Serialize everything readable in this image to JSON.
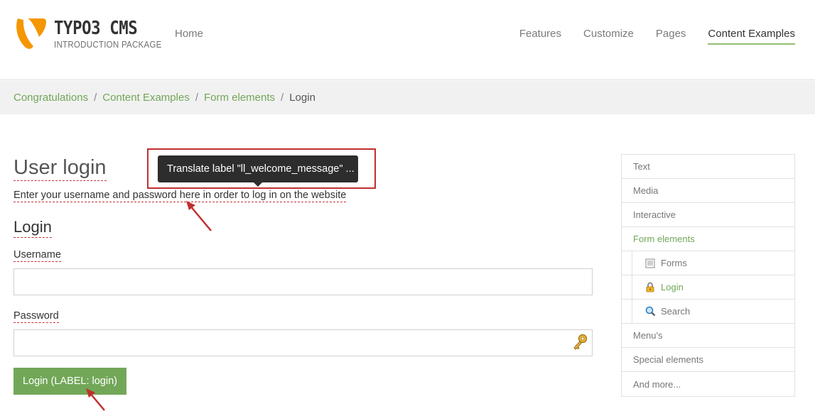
{
  "header": {
    "logo": {
      "title": "TYPO3 CMS",
      "subtitle": "INTRODUCTION PACKAGE",
      "brand_color": "#f49700"
    },
    "nav_home": "Home",
    "nav_items": [
      {
        "label": "Features",
        "active": false
      },
      {
        "label": "Customize",
        "active": false
      },
      {
        "label": "Pages",
        "active": false
      },
      {
        "label": "Content Examples",
        "active": true
      }
    ]
  },
  "breadcrumb": {
    "items": [
      "Congratulations",
      "Content Examples",
      "Form elements"
    ],
    "separator": "/",
    "current": "Login"
  },
  "main": {
    "title": "User login",
    "intro": "Enter your username and password here in order to log in on the website",
    "form_title": "Login",
    "username_label": "Username",
    "username_value": "",
    "password_label": "Password",
    "password_value": "",
    "password_icon": "key-icon",
    "submit_label": "Login (LABEL: login)"
  },
  "tooltip": {
    "text": "Translate label \"ll_welcome_message\" ..."
  },
  "sidebar": {
    "items": [
      {
        "label": "Text",
        "active": false
      },
      {
        "label": "Media",
        "active": false
      },
      {
        "label": "Interactive",
        "active": false
      },
      {
        "label": "Form elements",
        "active": true
      }
    ],
    "subitems": [
      {
        "label": "Forms",
        "icon": "document-icon",
        "active": false
      },
      {
        "label": "Login",
        "icon": "lock-icon",
        "active": true
      },
      {
        "label": "Search",
        "icon": "magnifier-icon",
        "active": false
      }
    ],
    "items_after": [
      {
        "label": "Menu's"
      },
      {
        "label": "Special elements"
      },
      {
        "label": "And more..."
      }
    ]
  },
  "colors": {
    "accent_green": "#72a758",
    "annotation_red": "#c0302f",
    "tooltip_bg": "#2d2d2d"
  }
}
